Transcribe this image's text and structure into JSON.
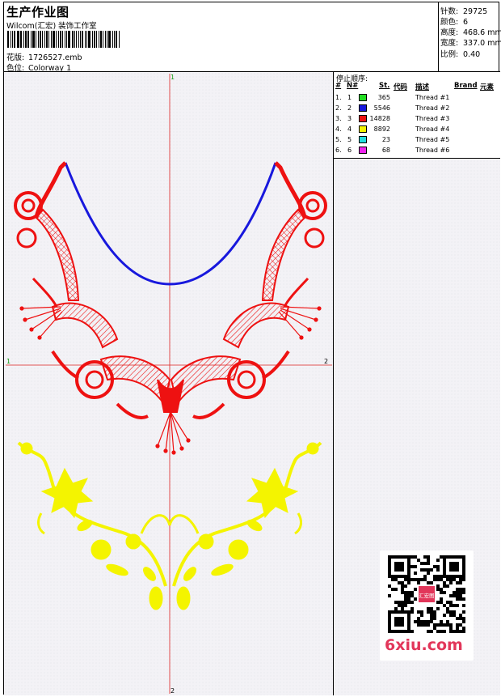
{
  "header": {
    "title": "生产作业图",
    "company": "Wilcom(汇宏) 装饰工作室",
    "design_label": "花版:",
    "design_file": "1726527.emb",
    "colorway_label": "色位:",
    "colorway": "Colorway 1"
  },
  "stats": {
    "stitches_label": "针数:",
    "stitches": "29725",
    "colors_label": "颜色:",
    "colors": "6",
    "height_label": "高度:",
    "height": "468.6 mm",
    "width_label": "宽度:",
    "width": "337.0 mm",
    "scale_label": "比例:",
    "scale": "0.40"
  },
  "thread_table": {
    "title": "停止顺序:",
    "columns": [
      "#",
      "N#",
      "St.",
      "代码",
      "描述",
      "Brand",
      "元素"
    ],
    "rows": [
      {
        "index": "1.",
        "n": "1",
        "color": "#22dd22",
        "stitches": "365",
        "code": "",
        "desc": "Thread #1",
        "brand": "",
        "element": ""
      },
      {
        "index": "2.",
        "n": "2",
        "color": "#1818dd",
        "stitches": "5546",
        "code": "",
        "desc": "Thread #2",
        "brand": "",
        "element": ""
      },
      {
        "index": "3.",
        "n": "3",
        "color": "#ee1111",
        "stitches": "14828",
        "code": "",
        "desc": "Thread #3",
        "brand": "",
        "element": ""
      },
      {
        "index": "4.",
        "n": "4",
        "color": "#f4f400",
        "stitches": "8892",
        "code": "",
        "desc": "Thread #4",
        "brand": "",
        "element": ""
      },
      {
        "index": "5.",
        "n": "5",
        "color": "#22dddd",
        "stitches": "23",
        "code": "",
        "desc": "Thread #5",
        "brand": "",
        "element": ""
      },
      {
        "index": "6.",
        "n": "6",
        "color": "#ee22ee",
        "stitches": "68",
        "code": "",
        "desc": "Thread #6",
        "brand": "",
        "element": ""
      }
    ]
  },
  "canvas": {
    "axis_top": "1",
    "axis_bottom": "2",
    "axis_left": "1",
    "axis_right": "2",
    "colors": {
      "red": "#ee1111",
      "blue": "#1818dd",
      "yellow": "#f4f400",
      "axis": "#dd2222"
    }
  },
  "watermark": {
    "site": "6xiu.com",
    "seal": "汇宏图"
  }
}
